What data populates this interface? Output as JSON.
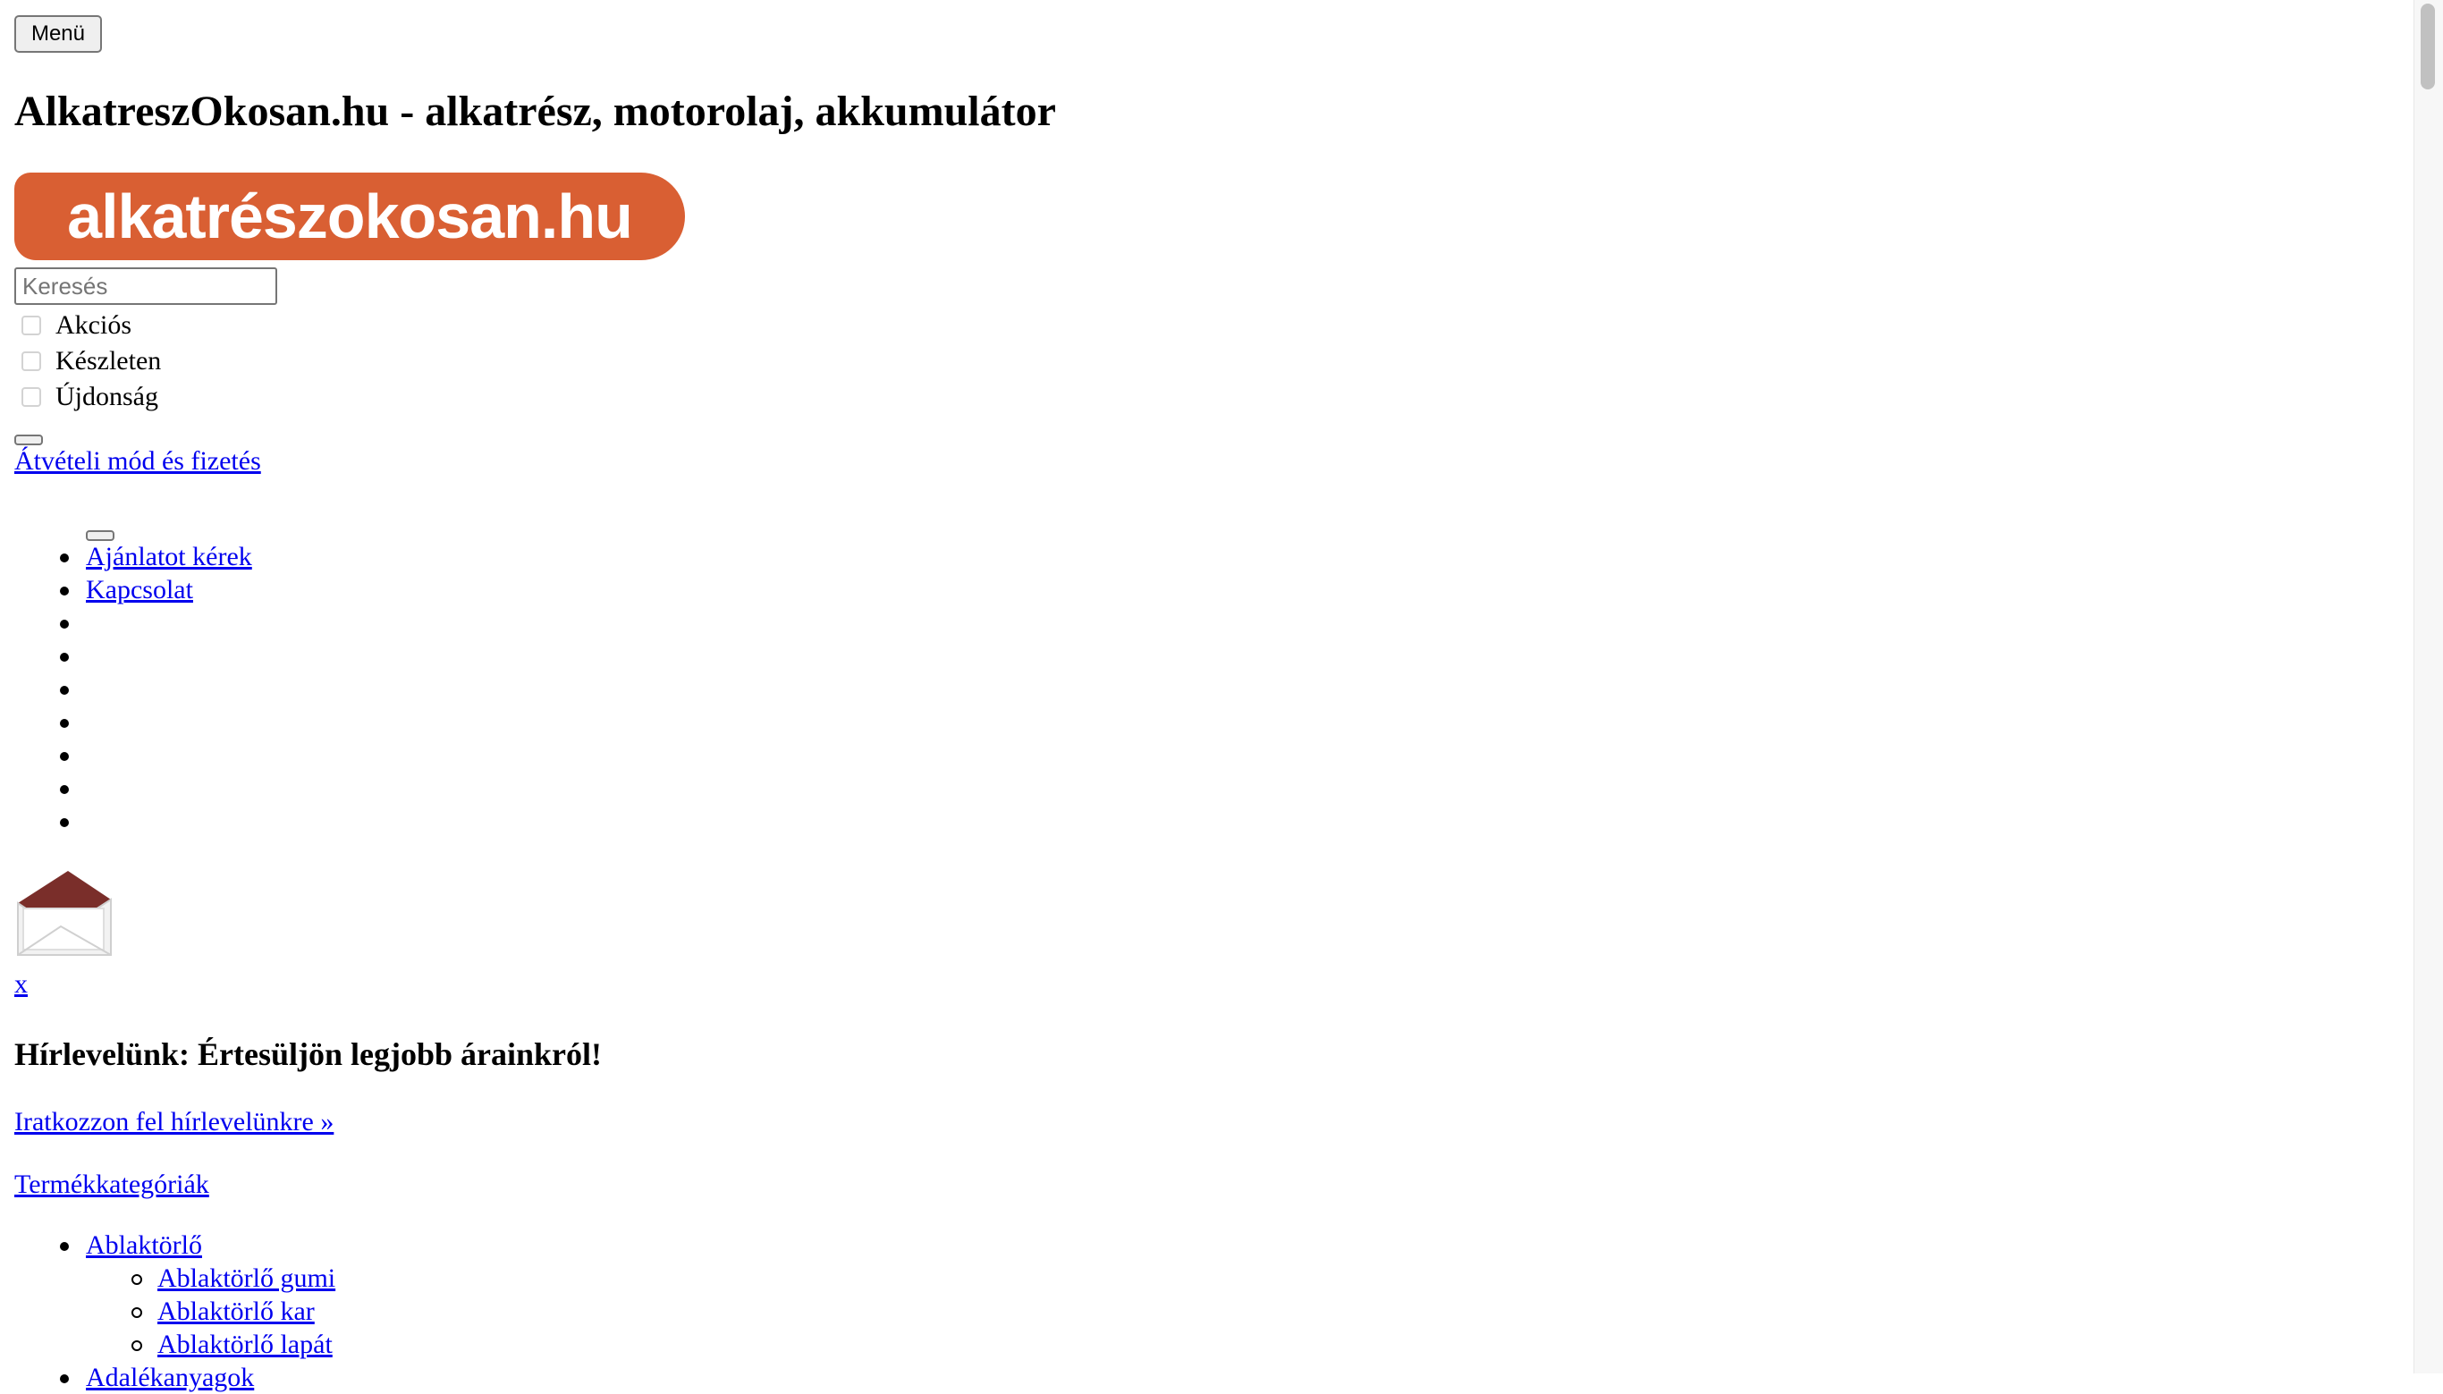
{
  "header": {
    "menu_label": "Menü",
    "site_title": "AlkatreszOkosan.hu - alkatrész, motorolaj, akkumulátor",
    "logo_text": "alkatrészokosan.hu",
    "brand_color": "#d95f33"
  },
  "search": {
    "placeholder": "Keresés",
    "value": ""
  },
  "filters": [
    {
      "label": "Akciós",
      "checked": false
    },
    {
      "label": "Készleten",
      "checked": false
    },
    {
      "label": "Újdonság",
      "checked": false
    }
  ],
  "shipping_link": "Átvételi mód és fizetés",
  "nav": {
    "items": [
      {
        "label": "Ajánlatot kérek"
      },
      {
        "label": "Kapcsolat"
      },
      {
        "label": ""
      },
      {
        "label": ""
      },
      {
        "label": ""
      },
      {
        "label": ""
      },
      {
        "label": ""
      },
      {
        "label": ""
      },
      {
        "label": ""
      }
    ]
  },
  "newsletter": {
    "icon": "envelope-icon",
    "close_label": "x",
    "title": "Hírlevelünk: Értesüljön legjobb árainkról!",
    "subscribe_link": "Iratkozzon fel hírlevelünkre »"
  },
  "categories": {
    "heading_link": "Termékkategóriák",
    "items": [
      {
        "label": "Ablaktörlő ",
        "level": 1
      },
      {
        "label": "Ablaktörlő gumi",
        "level": 2
      },
      {
        "label": "Ablaktörlő kar",
        "level": 2
      },
      {
        "label": "Ablaktörlő lapát",
        "level": 2
      },
      {
        "label": "Adalékanyagok",
        "level": 1
      }
    ]
  }
}
